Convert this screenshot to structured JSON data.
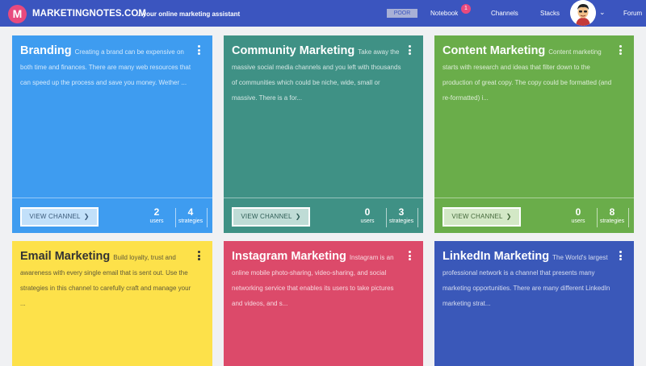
{
  "header": {
    "logo_letter": "M",
    "brand": "MARKETINGNOTES.COM",
    "tagline": "...your online marketing assistant",
    "status_badge": "POOR",
    "nav": {
      "notebook": "Notebook",
      "notebook_count": "1",
      "channels": "Channels",
      "stacks": "Stacks",
      "forum": "Forum"
    },
    "colors": {
      "bar": "#3b55bf",
      "accent": "#e84a7e"
    }
  },
  "cards": [
    {
      "title": "Branding",
      "description": "Creating a brand can be expensive on both time and finances. There are many web resources that can speed up the process and save you money. Wether ...",
      "button": "VIEW CHANNEL",
      "users": "2",
      "users_label": "users",
      "strategies": "4",
      "strategies_label": "strategies",
      "color": "#3e9cf0"
    },
    {
      "title": "Community Marketing",
      "description": "Take away the massive social media channels and you left with thousands of communities which could be niche, wide, small or massive. There is a for...",
      "button": "VIEW CHANNEL",
      "users": "0",
      "users_label": "users",
      "strategies": "3",
      "strategies_label": "strategies",
      "color": "#3f9185"
    },
    {
      "title": "Content Marketing",
      "description": "Content marketing starts with research and ideas that filter down to the production of great copy. The copy could be formatted (and re-formatted) i...",
      "button": "VIEW CHANNEL",
      "users": "0",
      "users_label": "users",
      "strategies": "8",
      "strategies_label": "strategies",
      "color": "#6aad4a"
    },
    {
      "title": "Email Marketing",
      "description": "Build loyalty, trust and awareness with every single email that is sent out. Use the strategies in this channel to carefully craft and manage your ...",
      "color": "#fde14a"
    },
    {
      "title": "Instagram Marketing",
      "description": "Instagram is an online mobile photo-sharing, video-sharing, and social networking service that enables its users to take pictures and videos, and s...",
      "color": "#dc4a6a"
    },
    {
      "title": "LinkedIn Marketing",
      "description": "The World's largest professional network is a channel that presents many marketing opportunities. There are many different LinkedIn marketing strat...",
      "color": "#3a58b9"
    }
  ]
}
